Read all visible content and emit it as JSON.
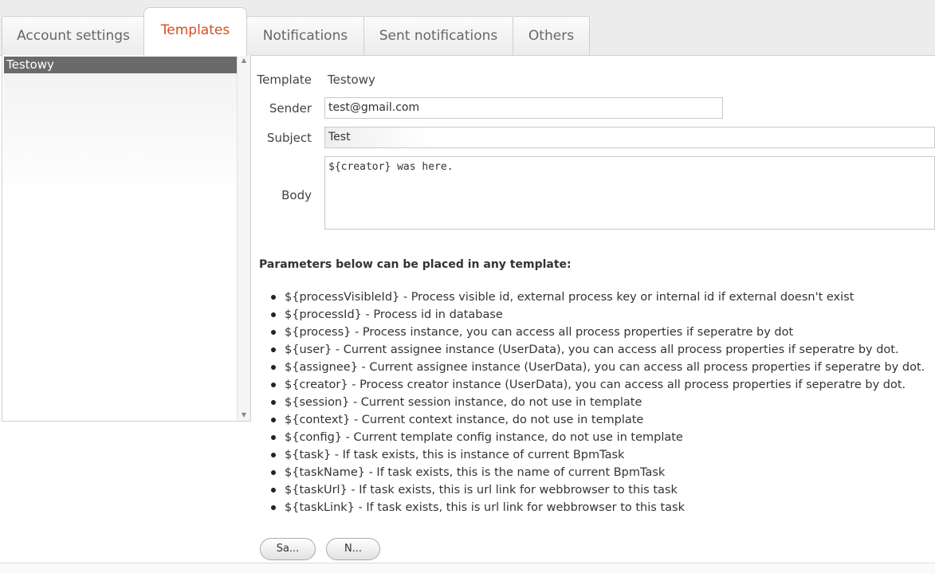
{
  "tabs": [
    {
      "label": "Account settings"
    },
    {
      "label": "Templates"
    },
    {
      "label": "Notifications"
    },
    {
      "label": "Sent notifications"
    },
    {
      "label": "Others"
    }
  ],
  "active_tab_color": "#d2501c",
  "template_list": {
    "items": [
      {
        "label": "Testowy"
      }
    ]
  },
  "form": {
    "template_label": "Template",
    "template_value": "Testowy",
    "sender_label": "Sender",
    "sender_value": "test@gmail.com",
    "subject_label": "Subject",
    "subject_value": "Test",
    "body_label": "Body",
    "body_value": "${creator} was here."
  },
  "params": {
    "heading": "Parameters below can be placed in any template:",
    "items": [
      "${processVisibleId} - Process visible id, external process key or internal id if external doesn't exist",
      "${processId} - Process id in database",
      "${process} - Process instance, you can access all process properties if seperatre by dot",
      "${user} - Current assignee instance (UserData), you can access all process properties if seperatre by dot.",
      "${assignee} - Current assignee instance (UserData), you can access all process properties if seperatre by dot.",
      "${creator} - Process creator instance (UserData), you can access all process properties if seperatre by dot.",
      "${session} - Current session instance, do not use in template",
      "${context} - Current context instance, do not use in template",
      "${config} - Current template config instance, do not use in template",
      "${task} - If task exists, this is instance of current BpmTask",
      "${taskName} - If task exists, this is the name of current BpmTask",
      "${taskUrl} - If task exists, this is url link for webbrowser to this task",
      "${taskLink} - If task exists, this is url link for webbrowser to this task"
    ]
  },
  "buttons": {
    "save_label": "Sa...",
    "new_label": "N..."
  }
}
